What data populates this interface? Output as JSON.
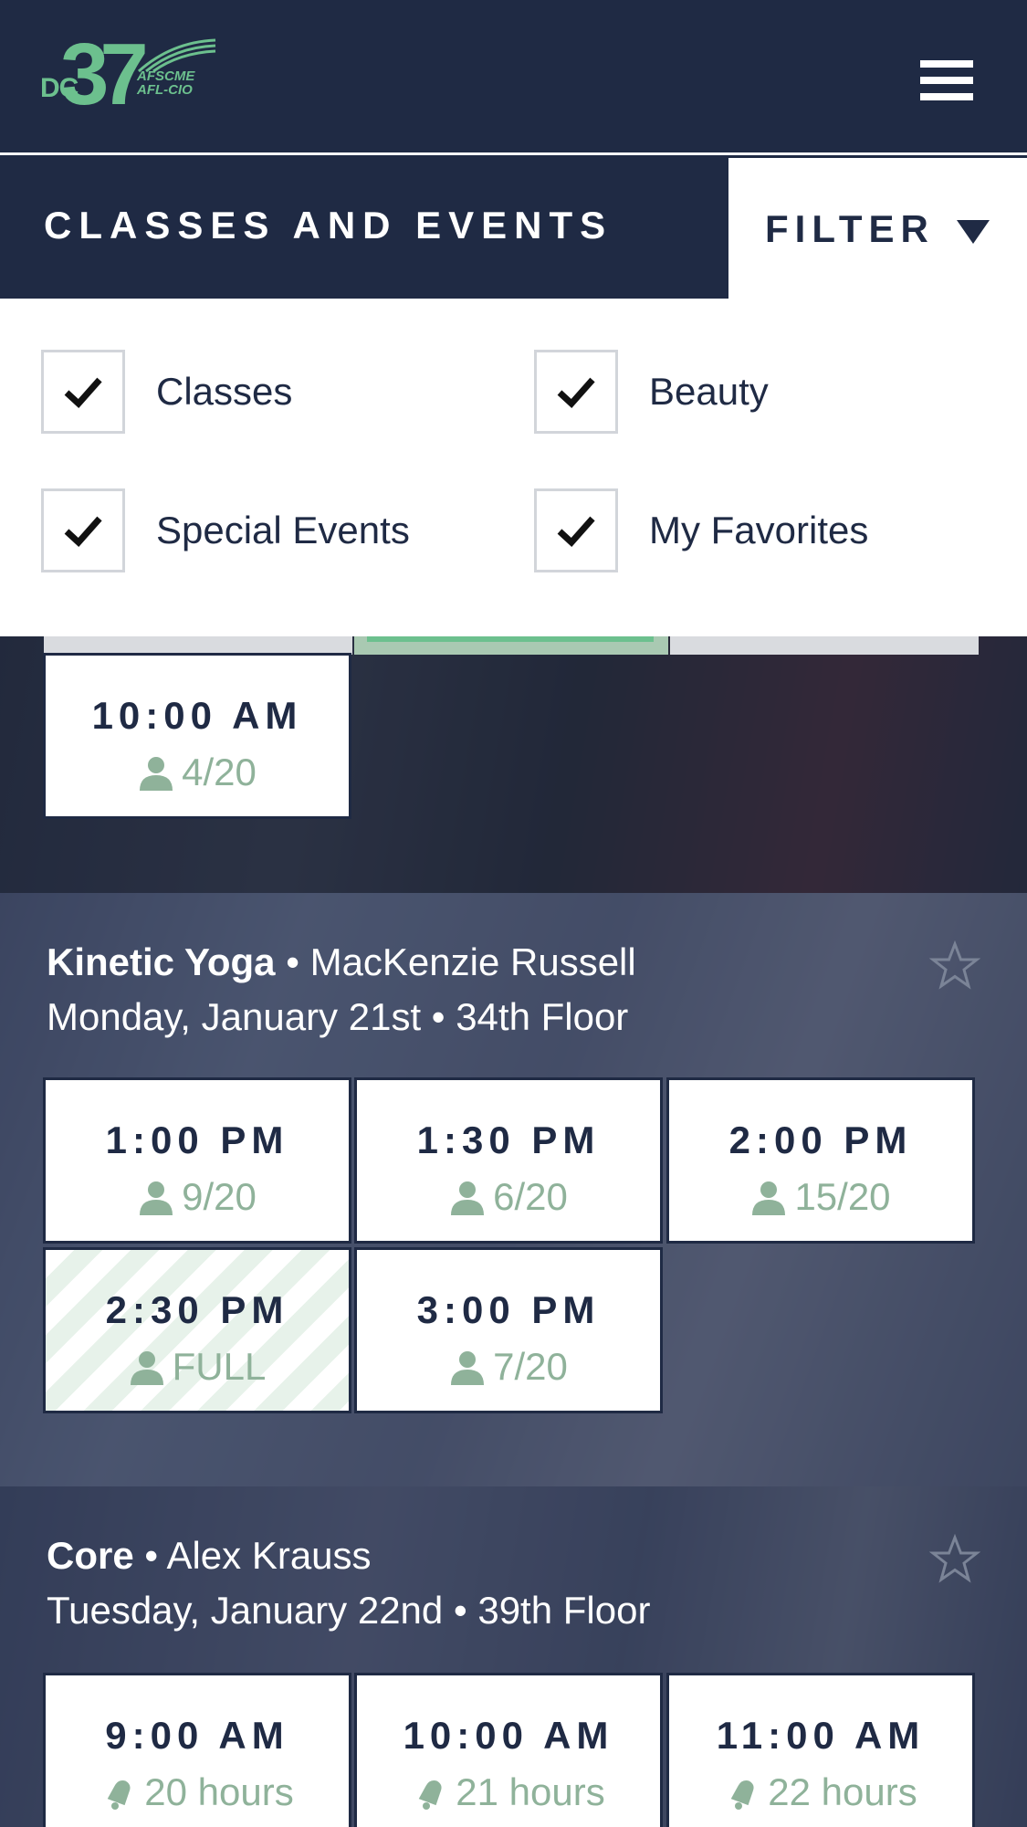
{
  "header": {
    "logo": {
      "dc": "DC",
      "number": "37",
      "line1": "AFSCME",
      "line2": "AFL-CIO"
    },
    "menu_icon": "hamburger-menu-icon"
  },
  "page": {
    "title": "CLASSES AND EVENTS"
  },
  "filter": {
    "label": "FILTER",
    "options": [
      {
        "label": "Classes",
        "checked": true
      },
      {
        "label": "Beauty",
        "checked": true
      },
      {
        "label": "Special Events",
        "checked": true
      },
      {
        "label": "My Favorites",
        "checked": true
      }
    ]
  },
  "classes": [
    {
      "slots": [
        {
          "time": "10:00 AM",
          "capacity": "4/20",
          "icon": "person-icon"
        }
      ]
    },
    {
      "name": "Kinetic Yoga",
      "instructor": "MacKenzie Russell",
      "date": "Monday, January 21st",
      "floor": "34th Floor",
      "favorite": false,
      "slots": [
        {
          "time": "1:00 PM",
          "capacity": "9/20",
          "icon": "person-icon"
        },
        {
          "time": "1:30 PM",
          "capacity": "6/20",
          "icon": "person-icon"
        },
        {
          "time": "2:00 PM",
          "capacity": "15/20",
          "icon": "person-icon"
        },
        {
          "time": "2:30 PM",
          "capacity": "FULL",
          "icon": "person-icon",
          "full": true
        },
        {
          "time": "3:00 PM",
          "capacity": "7/20",
          "icon": "person-icon"
        }
      ]
    },
    {
      "name": "Core",
      "instructor": "Alex Krauss",
      "date": "Tuesday, January 22nd",
      "floor": "39th Floor",
      "favorite": false,
      "slots": [
        {
          "time": "9:00 AM",
          "capacity": "20 hours",
          "icon": "bell-icon"
        },
        {
          "time": "10:00 AM",
          "capacity": "21 hours",
          "icon": "bell-icon"
        },
        {
          "time": "11:00 AM",
          "capacity": "22 hours",
          "icon": "bell-icon"
        }
      ]
    }
  ],
  "separator": "•",
  "colors": {
    "navy": "#1f2a44",
    "accent_green": "#6cc08e",
    "capacity_green": "#8fb29a"
  }
}
